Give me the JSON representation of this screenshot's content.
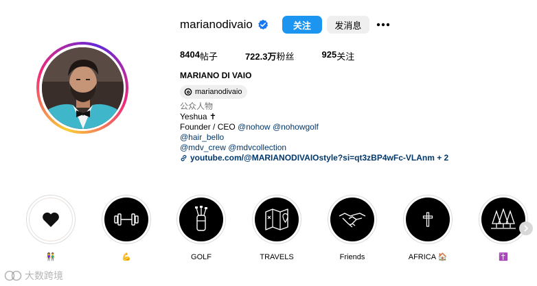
{
  "profile": {
    "username": "marianodivaio",
    "follow_label": "关注",
    "message_label": "发消息"
  },
  "stats": {
    "posts_count": "8404",
    "posts_label": "帖子",
    "followers_count": "722.3万",
    "followers_label": "粉丝",
    "following_count": "925",
    "following_label": "关注"
  },
  "bio": {
    "full_name": "MARIANO DI VAIO",
    "threads_handle": "marianodivaio",
    "category": "公众人物",
    "line1": "Yeshua ✝",
    "line2_prefix": "Founder / CEO ",
    "line2_mention1": "@nohow",
    "line2_mention2": "@nohowgolf",
    "line3_mention": "@hair_bello",
    "line4_mention1": "@mdv_crew",
    "line4_mention2": "@mdvcollection",
    "link": "youtube.com/@MARIANODIVAIOstyle?si=qt3zBP4wFc-VLAnm + 2"
  },
  "highlights": [
    {
      "label": "👫",
      "icon": "heart-icon"
    },
    {
      "label": "💪",
      "icon": "dumbbell-icon"
    },
    {
      "label": "GOLF",
      "icon": "golf-bag-icon"
    },
    {
      "label": "TRAVELS",
      "icon": "map-icon"
    },
    {
      "label": "Friends",
      "icon": "handshake-icon"
    },
    {
      "label": "AFRICA 🏠",
      "icon": "cross-icon"
    },
    {
      "label": "✝️",
      "icon": "trees-icon"
    }
  ],
  "watermark": "大数跨境",
  "colors": {
    "follow_button": "#1b95f0",
    "link": "#00376b",
    "verified": "#1877f2"
  }
}
